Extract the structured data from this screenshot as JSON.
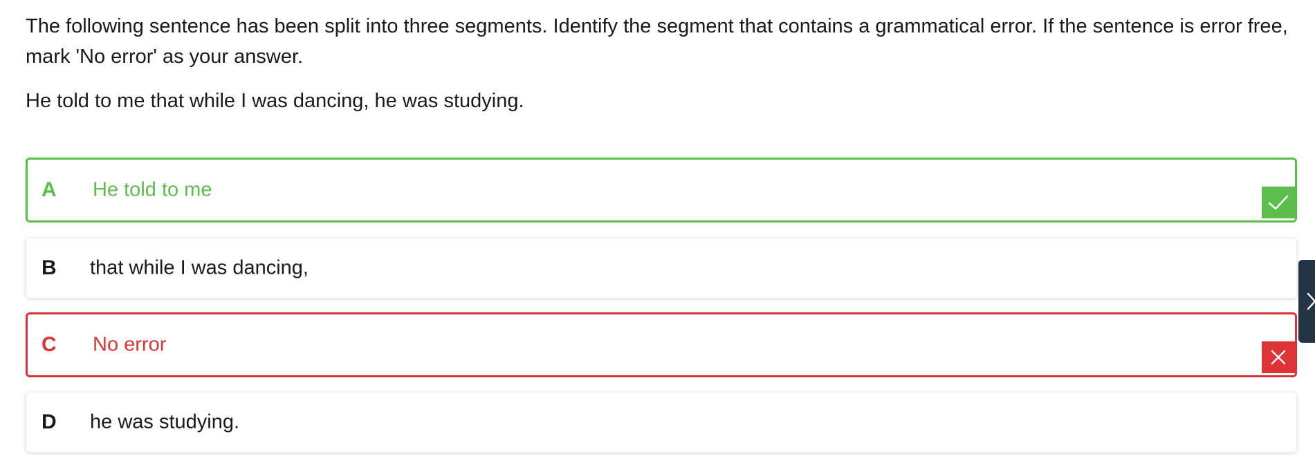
{
  "question": {
    "instructions": "The following sentence has been split into three segments. Identify the segment that contains a grammatical error. If the sentence is error free, mark 'No error' as your answer.",
    "sentence": "He told to me that while I was dancing, he was studying."
  },
  "options": [
    {
      "letter": "A",
      "text": "He told to me",
      "state": "correct"
    },
    {
      "letter": "B",
      "text": "that while I was dancing,",
      "state": "neutral"
    },
    {
      "letter": "C",
      "text": "No error",
      "state": "wrong"
    },
    {
      "letter": "D",
      "text": "he was studying.",
      "state": "neutral"
    }
  ],
  "icons": {
    "correct": "check-icon",
    "wrong": "close-icon",
    "side_tab": "chevron-right-icon"
  },
  "colors": {
    "correct": "#5bbd4a",
    "wrong": "#dc3436",
    "side_tab": "#243447"
  }
}
